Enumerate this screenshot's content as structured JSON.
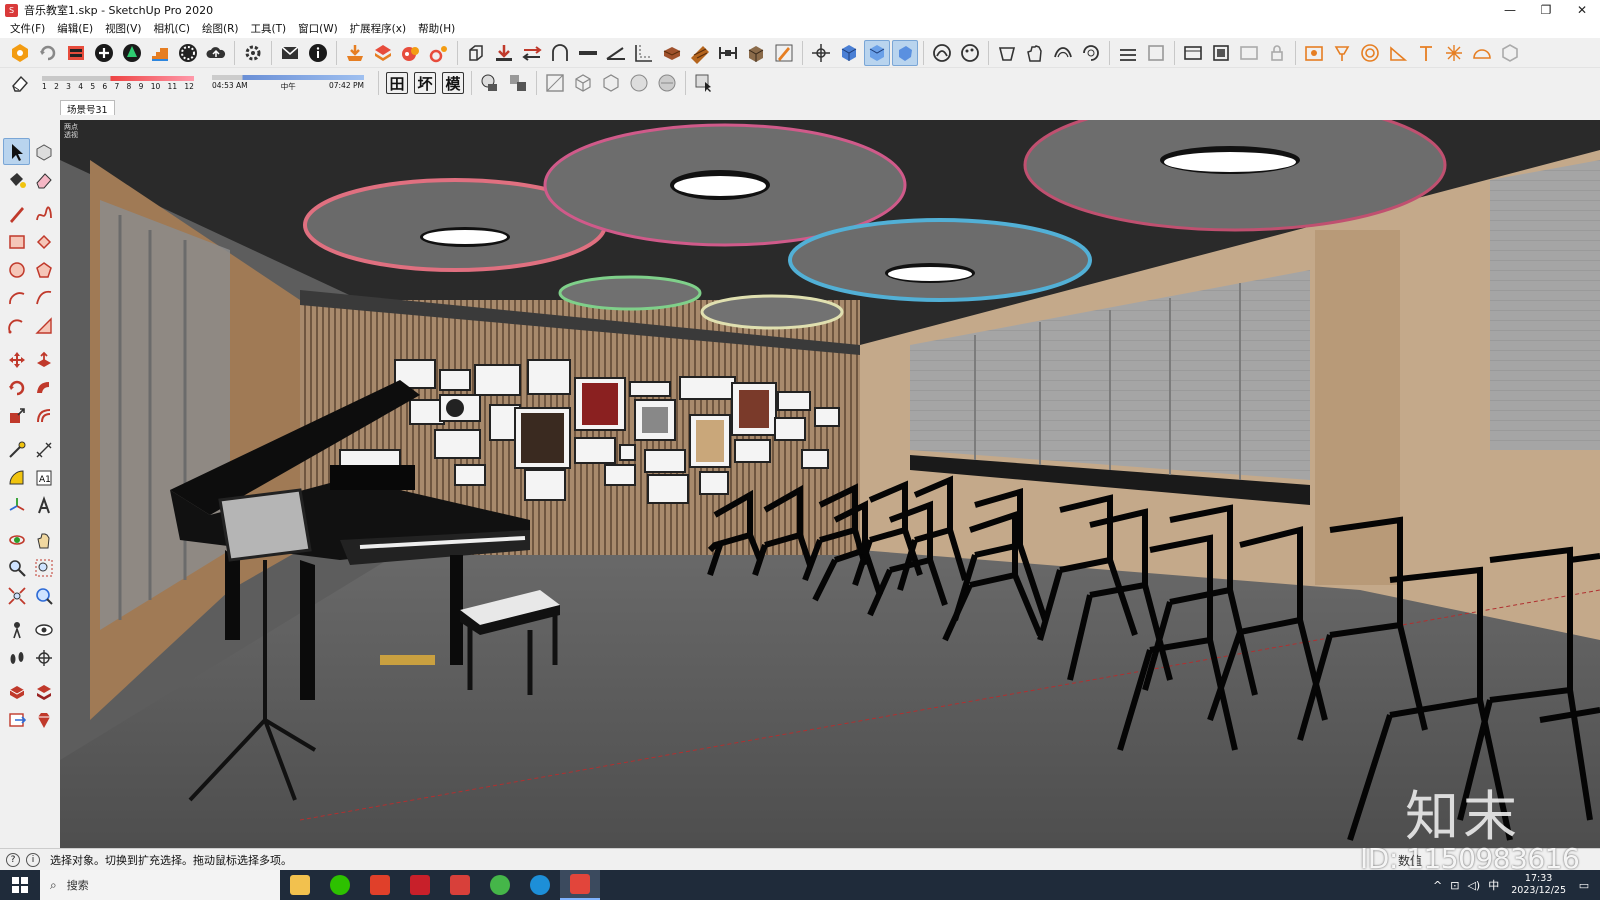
{
  "window": {
    "title": "音乐教室1.skp - SketchUp Pro 2020",
    "controls": [
      "—",
      "❐",
      "✕"
    ]
  },
  "menu": [
    "文件(F)",
    "编辑(E)",
    "视图(V)",
    "相机(C)",
    "绘图(R)",
    "工具(T)",
    "窗口(W)",
    "扩展程序(x)",
    "帮助(H)"
  ],
  "shadow": {
    "months": [
      "1",
      "2",
      "3",
      "4",
      "5",
      "6",
      "7",
      "8",
      "9",
      "10",
      "11",
      "12"
    ],
    "time_start": "04:53 AM",
    "time_mid": "中午",
    "time_end": "07:42 PM"
  },
  "toolbar2_text_buttons": [
    "田",
    "坏",
    "模"
  ],
  "scene_tabs": [
    "场景号31"
  ],
  "viewport": {
    "label": "两点透视",
    "background": "#5d5d5d"
  },
  "status": {
    "text": "选择对象。切换到扩充选择。拖动鼠标选择多项。",
    "measure_label": "数值"
  },
  "watermark": {
    "id": "ID: 1150983616",
    "logo": "知末"
  },
  "taskbar": {
    "search_placeholder": "搜索",
    "time": "17:33",
    "date": "2023/12/25",
    "ime": "中"
  },
  "colors": {
    "accent": "#d93a3a",
    "taskbar": "#1f2b3a",
    "selected_tool": "#b9d4ee"
  }
}
